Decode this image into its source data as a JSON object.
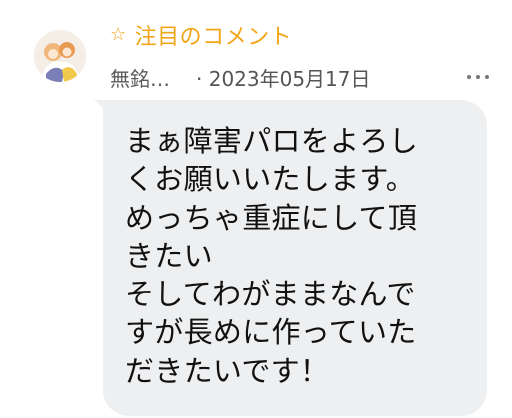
{
  "comment": {
    "featured_label": "注目のコメント",
    "featured_icon": "star-outline-icon",
    "author": "無銘…",
    "date": "· 2023年05月17日",
    "more_icon": "more-dots-icon",
    "body": "まぁ障害パロをよろし\nくお願いいたします。\nめっちゃ重症にして頂\nきたい\nそしてわがままなんで\nすが長めに作っていた\nだきたいです！",
    "bubble_color": "#eeeff1",
    "accent_color": "#f2a516"
  }
}
